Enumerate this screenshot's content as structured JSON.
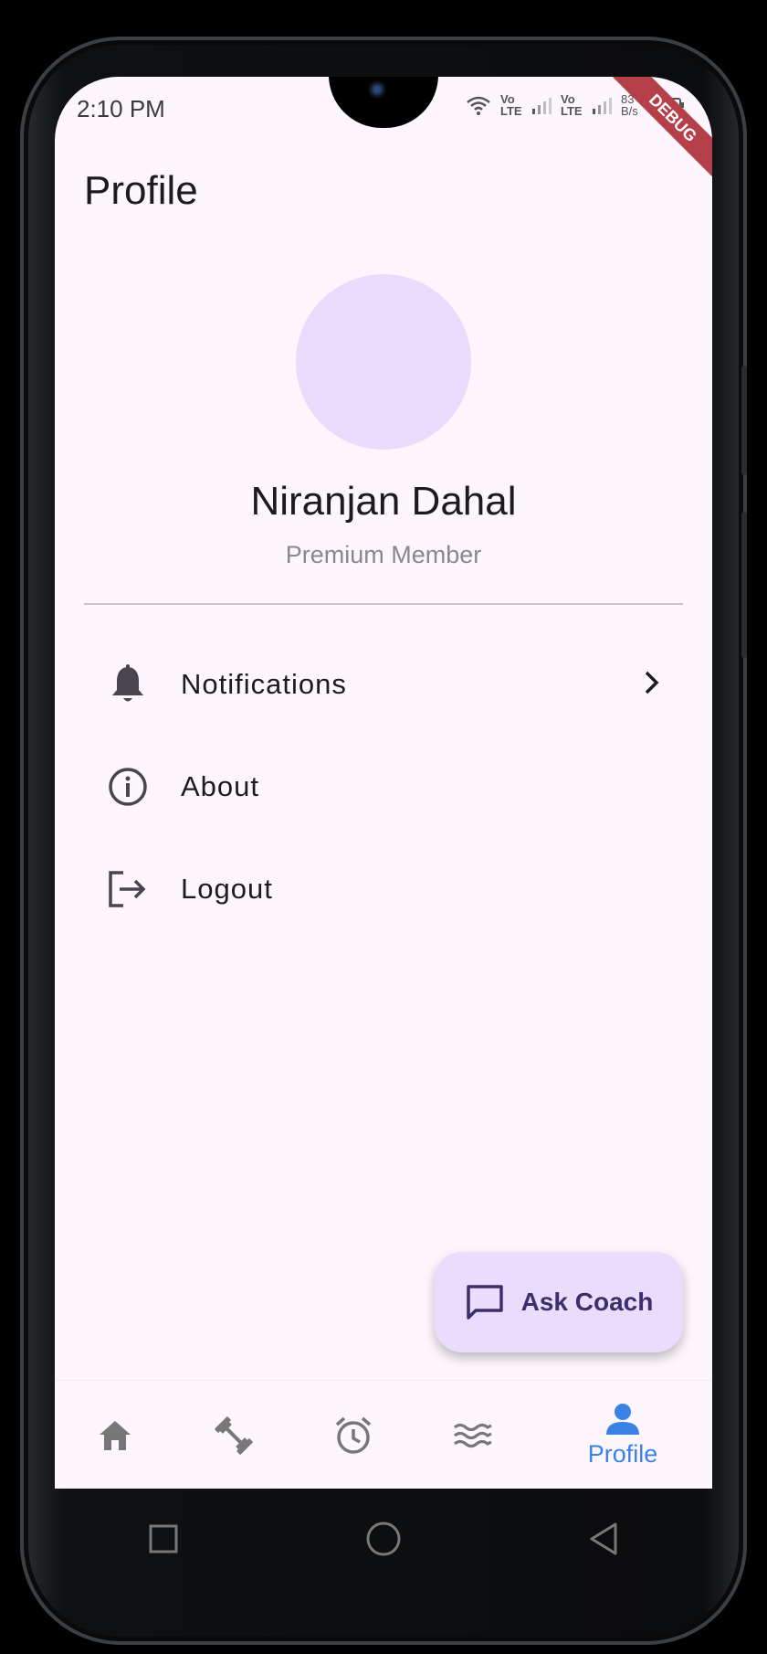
{
  "status_bar": {
    "time": "2:10 PM",
    "lte1": "Vo LTE",
    "lte2": "Vo LTE",
    "net_speed": "83 B/s"
  },
  "debug_banner": "DEBUG",
  "appbar": {
    "title": "Profile"
  },
  "profile": {
    "name": "Niranjan Dahal",
    "membership": "Premium Member"
  },
  "menu": {
    "items": [
      {
        "label": "Notifications",
        "icon": "bell-icon",
        "has_chevron": true
      },
      {
        "label": "About",
        "icon": "info-icon",
        "has_chevron": false
      },
      {
        "label": "Logout",
        "icon": "logout-icon",
        "has_chevron": false
      }
    ]
  },
  "fab": {
    "label": "Ask Coach",
    "icon": "chat-bubble-icon"
  },
  "bottom_nav": {
    "items": [
      {
        "icon": "home-icon",
        "label": ""
      },
      {
        "icon": "dumbbell-icon",
        "label": ""
      },
      {
        "icon": "alarm-clock-icon",
        "label": ""
      },
      {
        "icon": "waves-icon",
        "label": ""
      },
      {
        "icon": "person-icon",
        "label": "Profile",
        "active": true
      }
    ]
  },
  "colors": {
    "background": "#fdf7fd",
    "accent": "#3b82e6",
    "avatar": "#e9ddfd",
    "fab": "#e9ddfd",
    "debug": "#b5404a"
  }
}
